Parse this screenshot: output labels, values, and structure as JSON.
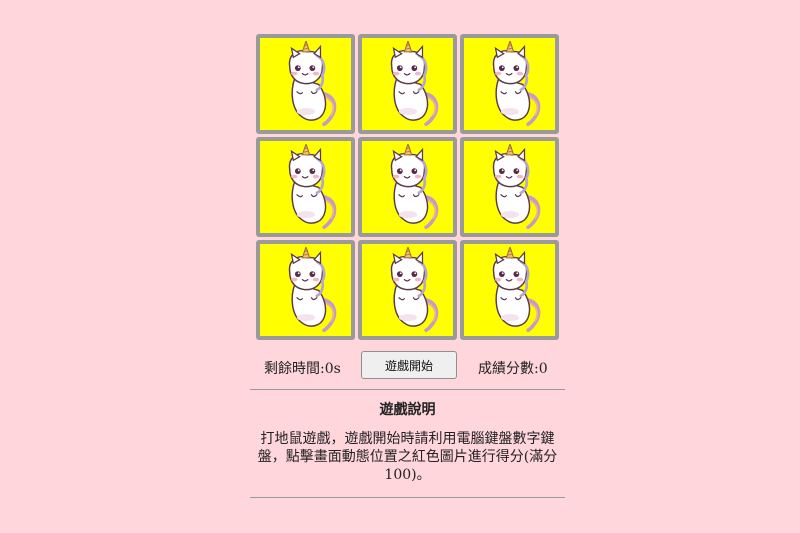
{
  "board": {
    "cells": [
      {
        "id": "1",
        "image": "unicorn-icon"
      },
      {
        "id": "2",
        "image": "unicorn-icon"
      },
      {
        "id": "3",
        "image": "unicorn-icon"
      },
      {
        "id": "4",
        "image": "unicorn-icon"
      },
      {
        "id": "5",
        "image": "unicorn-icon"
      },
      {
        "id": "6",
        "image": "unicorn-icon"
      },
      {
        "id": "7",
        "image": "unicorn-icon"
      },
      {
        "id": "8",
        "image": "unicorn-icon"
      },
      {
        "id": "9",
        "image": "unicorn-icon"
      }
    ]
  },
  "status": {
    "time_remaining": "剩餘時間:0s",
    "start_label": "遊戲開始",
    "score": "成績分數:0"
  },
  "instructions": {
    "title": "遊戲說明",
    "text": "打地鼠遊戲，遊戲開始時請利用電腦鍵盤數字鍵盤，點擊畫面動態位置之紅色圖片進行得分(滿分100)。"
  },
  "colors": {
    "background": "#ffd6dc",
    "cell": "#ffff00",
    "cell_border": "#9a9a9a"
  }
}
